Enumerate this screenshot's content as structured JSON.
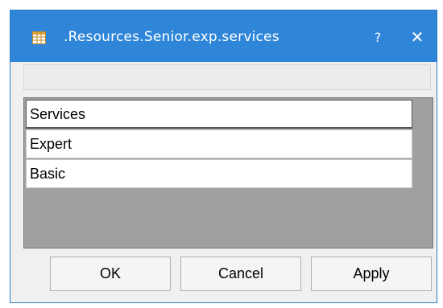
{
  "window": {
    "title": ".Resources.Senior.exp.services",
    "app_icon": "table-icon",
    "help_label": "?",
    "close_label": "✕",
    "titlebar_color": "#2f86d8"
  },
  "filter": {
    "value": ""
  },
  "list": {
    "header": "Services",
    "items": [
      "Expert",
      "Basic"
    ]
  },
  "buttons": {
    "ok": "OK",
    "cancel": "Cancel",
    "apply": "Apply"
  }
}
